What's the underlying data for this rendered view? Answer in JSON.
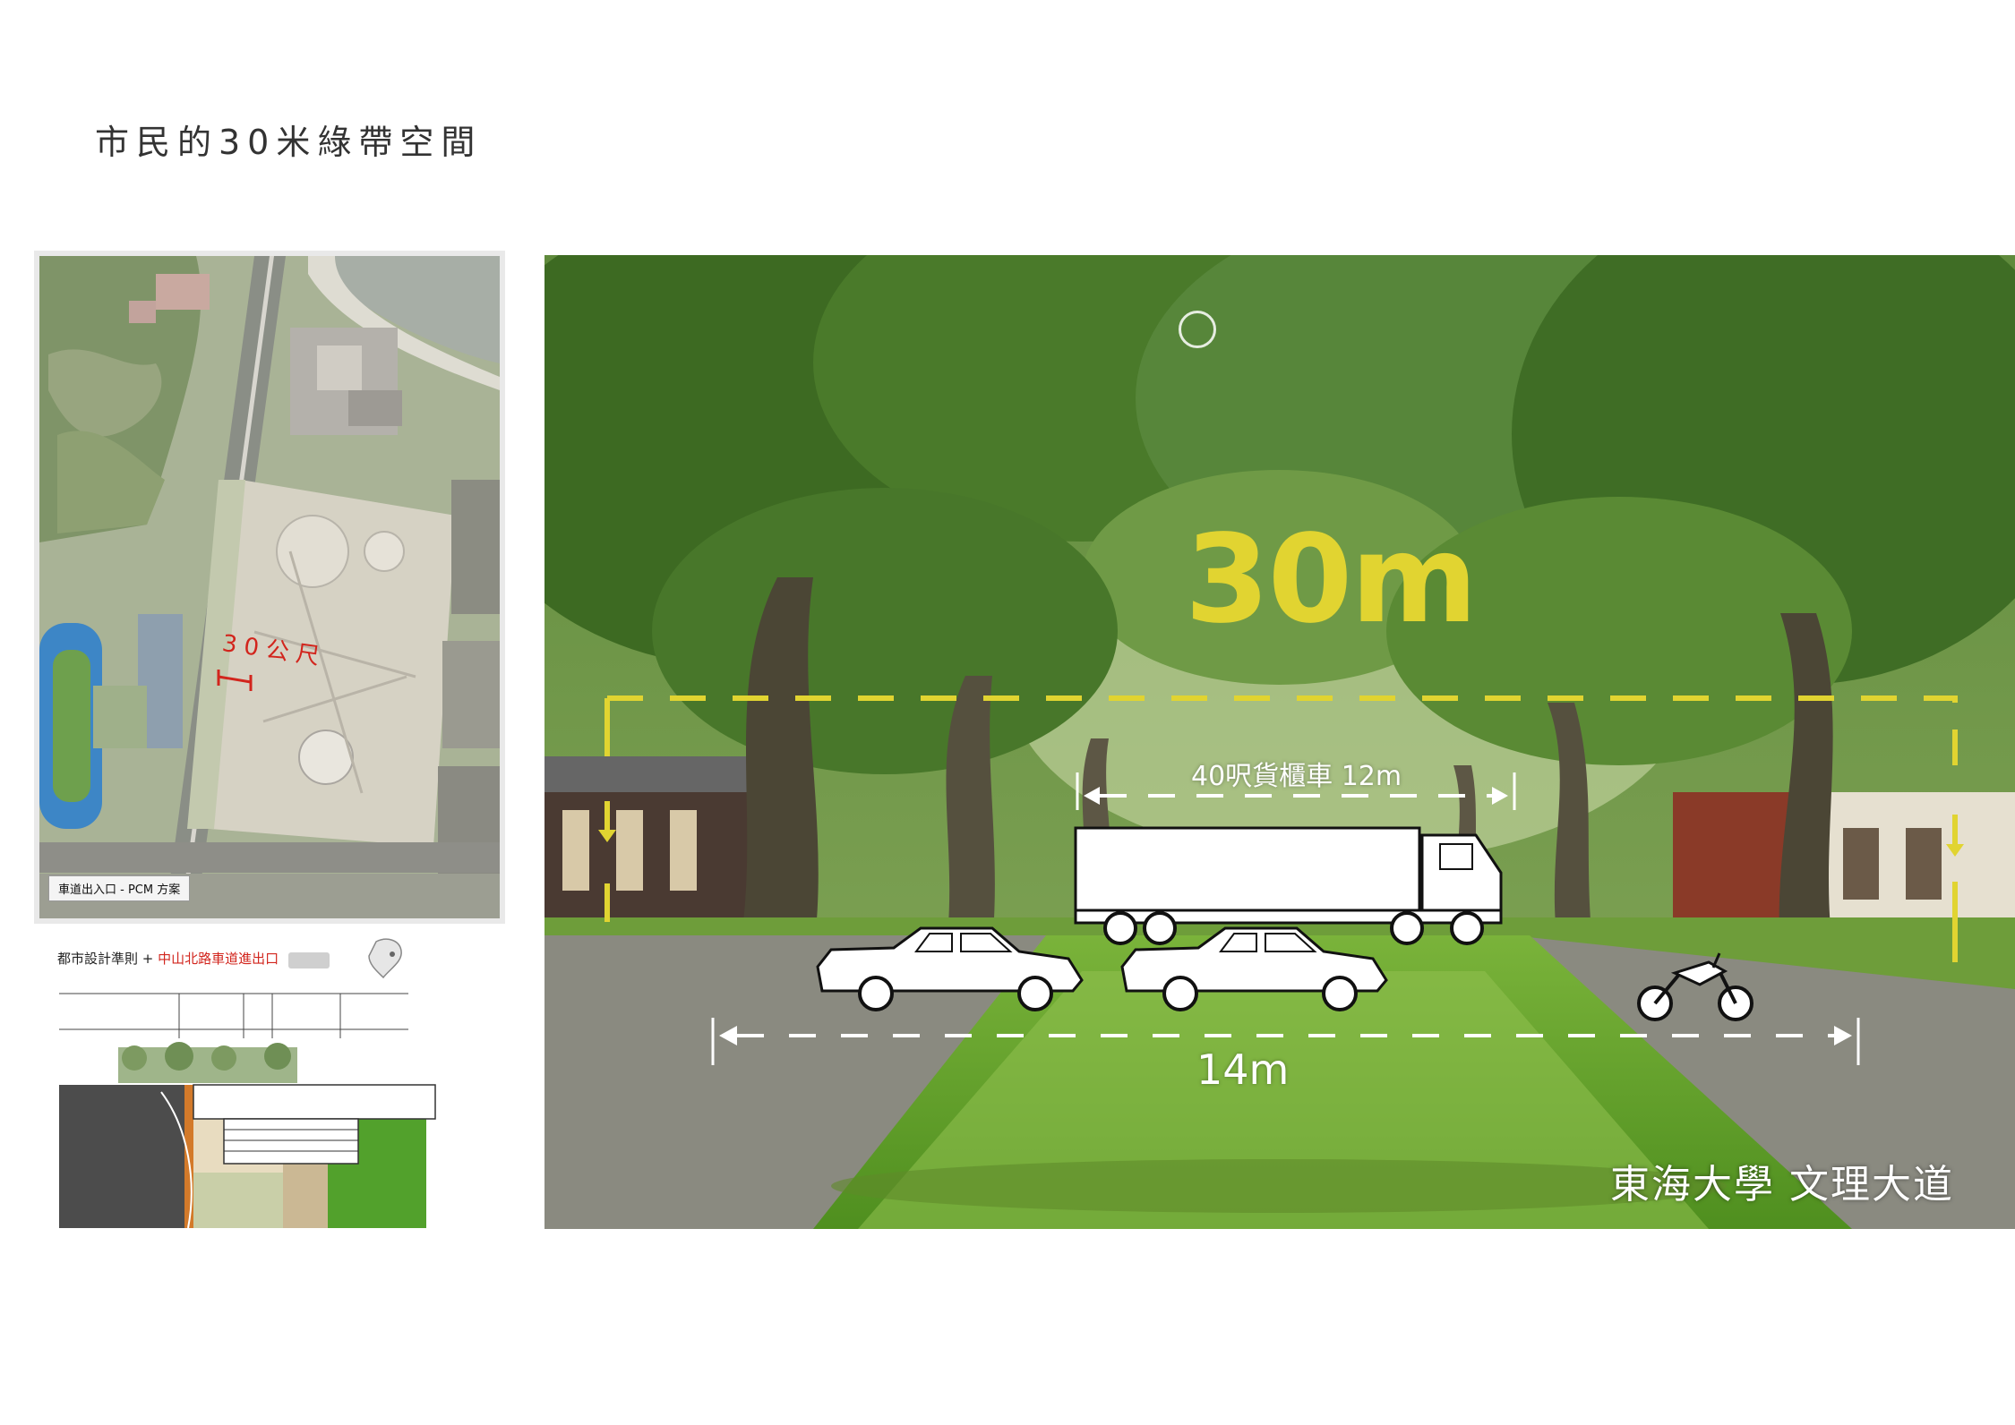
{
  "page": {
    "title": "市民的30米綠帶空間"
  },
  "map": {
    "caption": "車道出入口 - PCM 方案",
    "annotation": "30公尺"
  },
  "section_drawing": {
    "header_prefix": "都市設計準則 + ",
    "header_highlight": "中山北路車道進出口"
  },
  "photo": {
    "big_measure": "30m",
    "truck_measure": "40呎貨櫃車 12m",
    "road_measure": "14m",
    "caption": "東海大學  文理大道"
  },
  "colors": {
    "accent_yellow": "#e1d431",
    "dim_white": "#ffffff",
    "annotation_red": "#d2251d"
  }
}
